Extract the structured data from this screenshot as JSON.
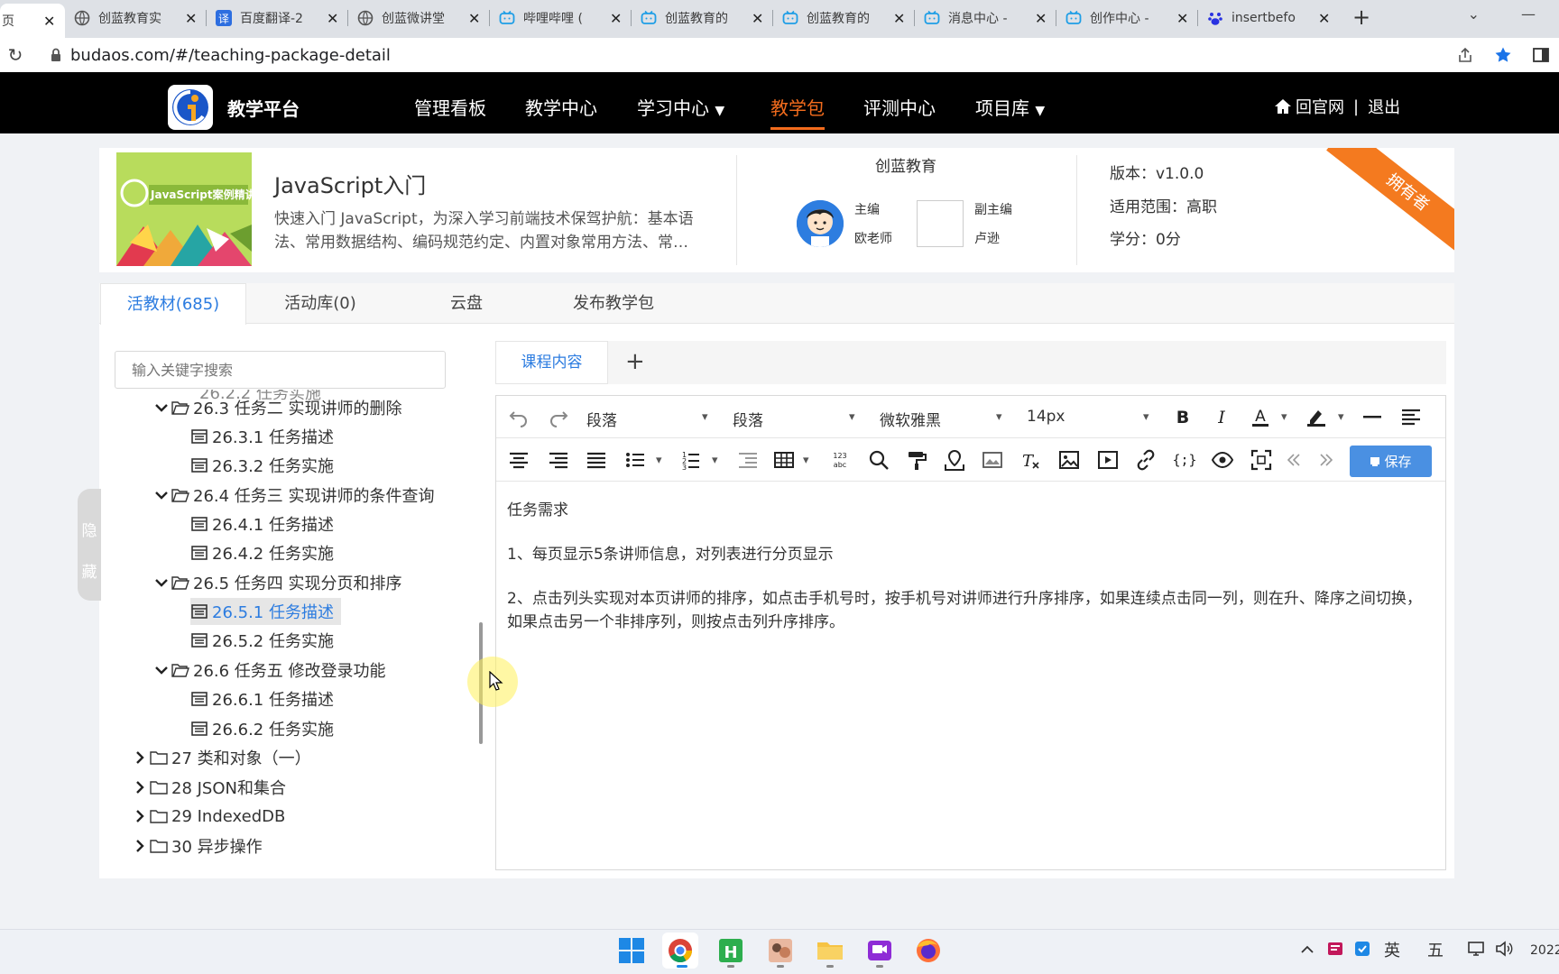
{
  "browser": {
    "tabs": [
      {
        "title": "页",
        "icon": "page-icon",
        "active": true
      },
      {
        "title": "创蓝教育实",
        "icon": "globe-icon"
      },
      {
        "title": "百度翻译-2",
        "icon": "baidu-translate-icon"
      },
      {
        "title": "创蓝微讲堂",
        "icon": "globe-icon"
      },
      {
        "title": "哔哩哔哩 (",
        "icon": "bilibili-icon"
      },
      {
        "title": "创蓝教育的",
        "icon": "bilibili-icon"
      },
      {
        "title": "创蓝教育的",
        "icon": "bilibili-icon"
      },
      {
        "title": "消息中心 -",
        "icon": "bilibili-icon"
      },
      {
        "title": "创作中心 -",
        "icon": "bilibili-icon"
      },
      {
        "title": "insertbefo",
        "icon": "baidu-icon"
      }
    ],
    "new_tab": "+",
    "url": "budaos.com/#/teaching-package-detail"
  },
  "site": {
    "brand": "教学平台",
    "nav": [
      {
        "label": "管理看板"
      },
      {
        "label": "教学中心"
      },
      {
        "label": "学习中心",
        "dropdown": true
      },
      {
        "label": "教学包",
        "active": true
      },
      {
        "label": "评测中心"
      },
      {
        "label": "项目库",
        "dropdown": true
      }
    ],
    "home_link": "回官网",
    "divider": "|",
    "logout": "退出",
    "accent_color": "#f36c1d"
  },
  "package": {
    "cover_text": "JavaScript案例精讲",
    "title": "JavaScript入门",
    "description": "快速入门 JavaScript，为深入学习前端技术保驾护航：基本语法、常用数据结构、编码规范约定、内置对象常用方法、常…",
    "org": "创蓝教育",
    "editor_role": "主编",
    "editor_name": "欧老师",
    "co_editor_role": "副主编",
    "co_editor_name": "卢逊",
    "version": "版本：v1.0.0",
    "scope": "适用范围：高职",
    "credits": "学分：0分",
    "ribbon": "拥有者"
  },
  "main_tabs": [
    {
      "label": "活教材(685)",
      "active": true
    },
    {
      "label": "活动库(0)"
    },
    {
      "label": "云盘"
    },
    {
      "label": "发布教学包"
    }
  ],
  "tree": {
    "search_placeholder": "输入关键字搜索",
    "partial_top": "26.2.2 任务实施",
    "items": [
      {
        "label": "26.3 任务二 实现讲师的删除",
        "type": "folder-open"
      },
      {
        "label": "26.3.1 任务描述",
        "type": "doc"
      },
      {
        "label": "26.3.2 任务实施",
        "type": "doc"
      },
      {
        "label": "26.4 任务三 实现讲师的条件查询",
        "type": "folder-open"
      },
      {
        "label": "26.4.1 任务描述",
        "type": "doc"
      },
      {
        "label": "26.4.2 任务实施",
        "type": "doc"
      },
      {
        "label": "26.5 任务四 实现分页和排序",
        "type": "folder-open"
      },
      {
        "label": "26.5.1 任务描述",
        "type": "doc",
        "selected": true
      },
      {
        "label": "26.5.2 任务实施",
        "type": "doc"
      },
      {
        "label": "26.6 任务五 修改登录功能",
        "type": "folder-open"
      },
      {
        "label": "26.6.1 任务描述",
        "type": "doc"
      },
      {
        "label": "26.6.2 任务实施",
        "type": "doc"
      },
      {
        "label": "27 类和对象（一）",
        "type": "folder-closed"
      },
      {
        "label": "28 JSON和集合",
        "type": "folder-closed"
      },
      {
        "label": "29 IndexedDB",
        "type": "folder-closed"
      },
      {
        "label": "30 异步操作",
        "type": "folder-closed"
      }
    ],
    "hide_label_1": "隐",
    "hide_label_2": "藏"
  },
  "editor": {
    "tab_label": "课程内容",
    "add_tab": "+",
    "block_format_1": "段落",
    "block_format_2": "段落",
    "font_family": "微软雅黑",
    "font_size": "14px",
    "save_label": "保存",
    "content": {
      "heading": "任务需求",
      "p1": "1、每页显示5条讲师信息，对列表进行分页显示",
      "p2": "2、点击列头实现对本页讲师的排序，如点击手机号时，按手机号对讲师进行升序排序，如果连续点击同一列，则在升、降序之间切换，如果点击另一个非排序列，则按点击列升序排序。"
    }
  },
  "taskbar": {
    "ime_lang": "英",
    "ime_mode": "五",
    "clock": "2022"
  }
}
